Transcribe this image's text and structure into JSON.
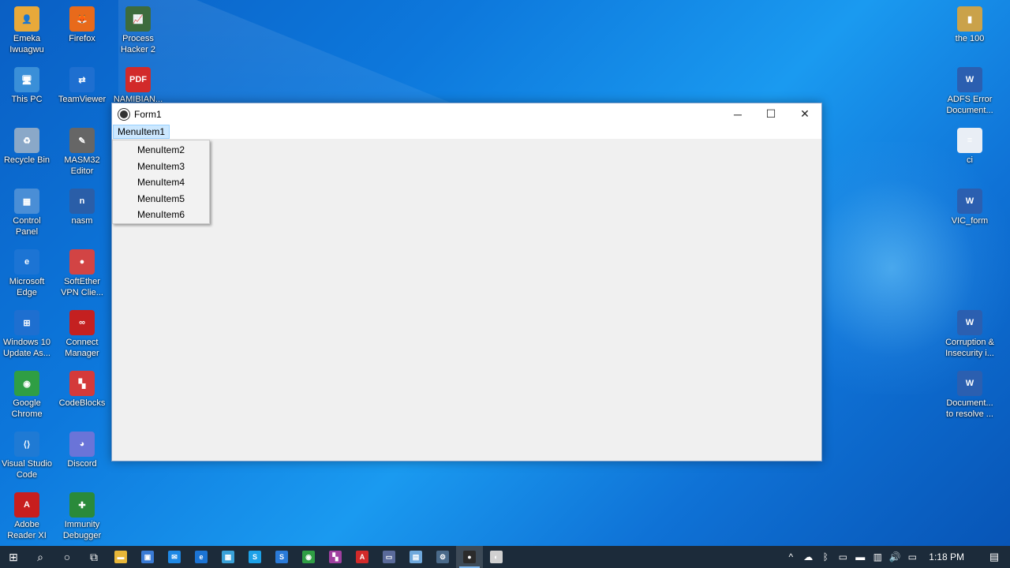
{
  "desktop": {
    "icons": [
      {
        "label": "Emeka\nIwuagwu",
        "glyph": "👤",
        "color": "#e8a93a"
      },
      {
        "label": "Firefox",
        "glyph": "🦊",
        "color": "#e86a1b"
      },
      {
        "label": "Process\nHacker 2",
        "glyph": "📈",
        "color": "#3d6b3d"
      },
      {
        "label": "the 100",
        "glyph": "▮",
        "color": "#caa24a"
      },
      {
        "label": "This PC",
        "glyph": "🖥",
        "color": "#3a8fd8"
      },
      {
        "label": "TeamViewer",
        "glyph": "⇄",
        "color": "#1e6fd0"
      },
      {
        "label": "NAMIBIAN...",
        "glyph": "PDF",
        "color": "#d22a2a"
      },
      {
        "label": "ADFS Error\nDocument...",
        "glyph": "W",
        "color": "#2b5fb0"
      },
      {
        "label": "Recycle Bin",
        "glyph": "♻",
        "color": "#8aa8c8"
      },
      {
        "label": "MASM32\nEditor",
        "glyph": "✎",
        "color": "#666666"
      },
      {
        "label": "ci",
        "glyph": "≡",
        "color": "#e9eef5"
      },
      {
        "label": "Control\nPanel",
        "glyph": "▦",
        "color": "#4a8ed6"
      },
      {
        "label": "nasm",
        "glyph": "n",
        "color": "#2a5ea8"
      },
      {
        "label": "VIC_form",
        "glyph": "W",
        "color": "#2b5fb0"
      },
      {
        "label": "Microsoft\nEdge",
        "glyph": "e",
        "color": "#1c74d4"
      },
      {
        "label": "SoftEther\nVPN Clie...",
        "glyph": "●",
        "color": "#d24444"
      },
      {
        "label": "Windows 10\nUpdate As...",
        "glyph": "⊞",
        "color": "#1e6fd0"
      },
      {
        "label": "Connect\nManager",
        "glyph": "∞",
        "color": "#c42020"
      },
      {
        "label": "Corruption &\nInsecurity i...",
        "glyph": "W",
        "color": "#2b5fb0"
      },
      {
        "label": "Google\nChrome",
        "glyph": "◉",
        "color": "#2f9e44"
      },
      {
        "label": "CodeBlocks",
        "glyph": "▚",
        "color": "#d43a3a"
      },
      {
        "label": "Document...\nto resolve ...",
        "glyph": "W",
        "color": "#2b5fb0"
      },
      {
        "label": "Visual Studio\nCode",
        "glyph": "⟨⟩",
        "color": "#1f7ad4"
      },
      {
        "label": "Discord",
        "glyph": "◕",
        "color": "#6a74d8"
      },
      {
        "label": "Adobe\nReader XI",
        "glyph": "A",
        "color": "#c81e1e"
      },
      {
        "label": "Immunity\nDebugger",
        "glyph": "✚",
        "color": "#2a8a3a"
      }
    ]
  },
  "window": {
    "title": "Form1",
    "minimize_label": "─",
    "maximize_label": "☐",
    "close_label": "✕",
    "menu": {
      "top_item": "MenuItem1",
      "items": [
        "MenuItem2",
        "MenuItem3",
        "MenuItem4",
        "MenuItem5",
        "MenuItem6"
      ]
    }
  },
  "taskbar": {
    "start_icon": "⊞",
    "search_icon": "⌕",
    "cortana_icon": "○",
    "taskview_icon": "⧉",
    "apps": [
      {
        "name": "file-explorer",
        "glyph": "▬",
        "color": "#e8b739"
      },
      {
        "name": "store",
        "glyph": "▣",
        "color": "#3a7bd5"
      },
      {
        "name": "mail",
        "glyph": "✉",
        "color": "#1e88e5"
      },
      {
        "name": "edge",
        "glyph": "e",
        "color": "#1c74d4"
      },
      {
        "name": "calculator",
        "glyph": "▦",
        "color": "#3aa1d8"
      },
      {
        "name": "skype",
        "glyph": "S",
        "color": "#1da1e8"
      },
      {
        "name": "skype-business",
        "glyph": "S",
        "color": "#2a7ad8"
      },
      {
        "name": "chrome",
        "glyph": "◉",
        "color": "#2f9e44"
      },
      {
        "name": "photo-app",
        "glyph": "▚",
        "color": "#a040a0"
      },
      {
        "name": "acrobat",
        "glyph": "A",
        "color": "#d22a2a"
      },
      {
        "name": "console-app",
        "glyph": "▭",
        "color": "#5a6a9a"
      },
      {
        "name": "notepad",
        "glyph": "▤",
        "color": "#6fa8dc"
      },
      {
        "name": "settings-app",
        "glyph": "⚙",
        "color": "#4a6a8a"
      },
      {
        "name": "form1-app",
        "glyph": "●",
        "color": "#2b2b2b"
      },
      {
        "name": "edge-legacy",
        "glyph": "◐",
        "color": "#d0d0d0"
      }
    ],
    "tray": {
      "chevron": "^",
      "cloud": "☁",
      "bluetooth": "ᛒ",
      "usb": "▭",
      "battery": "▬",
      "network": "▥",
      "volume": "🔊",
      "language": "▭",
      "time": "1:18 PM",
      "notification": "▤"
    }
  }
}
